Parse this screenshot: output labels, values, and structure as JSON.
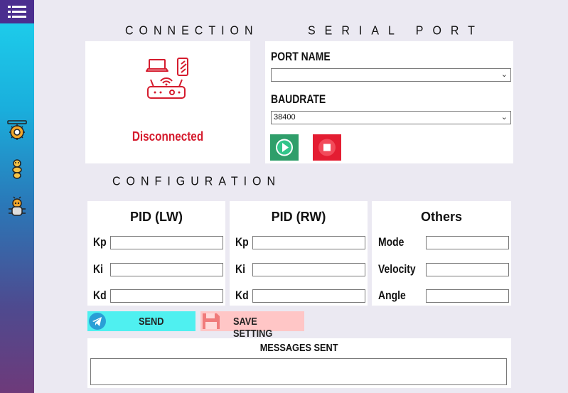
{
  "sidebar": {
    "menu_icon": "list-icon",
    "items": [
      {
        "name": "settings-gear-icon"
      },
      {
        "name": "robot-worm-icon"
      },
      {
        "name": "robot-bug-icon"
      }
    ]
  },
  "connection": {
    "heading": "CONNECTION",
    "icon": "network-devices-icon",
    "status": "Disconnected",
    "status_color": "#d51c2e"
  },
  "serial_port": {
    "heading": "SERIAL PORT",
    "port_label": "PORT NAME",
    "port_value": "",
    "baud_label": "BAUDRATE",
    "baud_value": "38400",
    "play_icon": "play-icon",
    "stop_icon": "stop-icon"
  },
  "configuration": {
    "heading": "CONFIGURATION",
    "pid_lw": {
      "title": "PID (LW)",
      "labels": [
        "Kp",
        "Ki",
        "Kd"
      ],
      "values": [
        "",
        "",
        ""
      ]
    },
    "pid_rw": {
      "title": "PID (RW)",
      "labels": [
        "Kp",
        "Ki",
        "Kd"
      ],
      "values": [
        "",
        "",
        ""
      ]
    },
    "others": {
      "title": "Others",
      "labels": [
        "Mode",
        "Velocity",
        "Angle"
      ],
      "values": [
        "",
        "",
        ""
      ]
    }
  },
  "actions": {
    "send_label": "SEND",
    "save_label": "SAVE SETTING",
    "send_color": "#4ff0f0",
    "save_color": "#ffc6c6"
  },
  "messages": {
    "title": "MESSAGES SENT",
    "content": ""
  }
}
